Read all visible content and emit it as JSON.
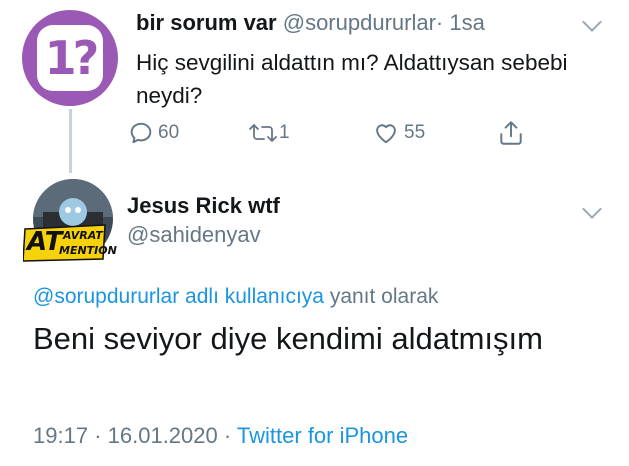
{
  "parent_tweet": {
    "avatar_glyph": "1?",
    "avatar_color": "#9b59b6",
    "name": "bir sorum var",
    "handle": "@sorupdururlar",
    "separator": "·",
    "time": "1sa",
    "text": "Hiç sevgilini aldattın mı? Aldattıysan sebebi neydi?",
    "actions": {
      "reply_icon": "reply-icon",
      "reply_count": "60",
      "retweet_icon": "retweet-icon",
      "retweet_count": "1",
      "like_icon": "heart-icon",
      "like_count": "55",
      "share_icon": "share-icon"
    }
  },
  "reply_tweet": {
    "name": "Jesus Rick wtf",
    "handle": "@sahidenyav",
    "avatar_text_top": "AVRAT",
    "avatar_text_left": "AT",
    "avatar_text_bottom": "MENTION",
    "reply_to_link": "@sorupdururlar adlı kullanıcıya",
    "reply_to_suffix": "yanıt olarak",
    "text": "Beni seviyor diye kendimi aldatmışım",
    "time": "19:17",
    "date": "16.01.2020",
    "separator": "·",
    "source": "Twitter for iPhone"
  },
  "colors": {
    "link": "#1b95e0",
    "muted": "#657786",
    "text": "#14171a"
  }
}
